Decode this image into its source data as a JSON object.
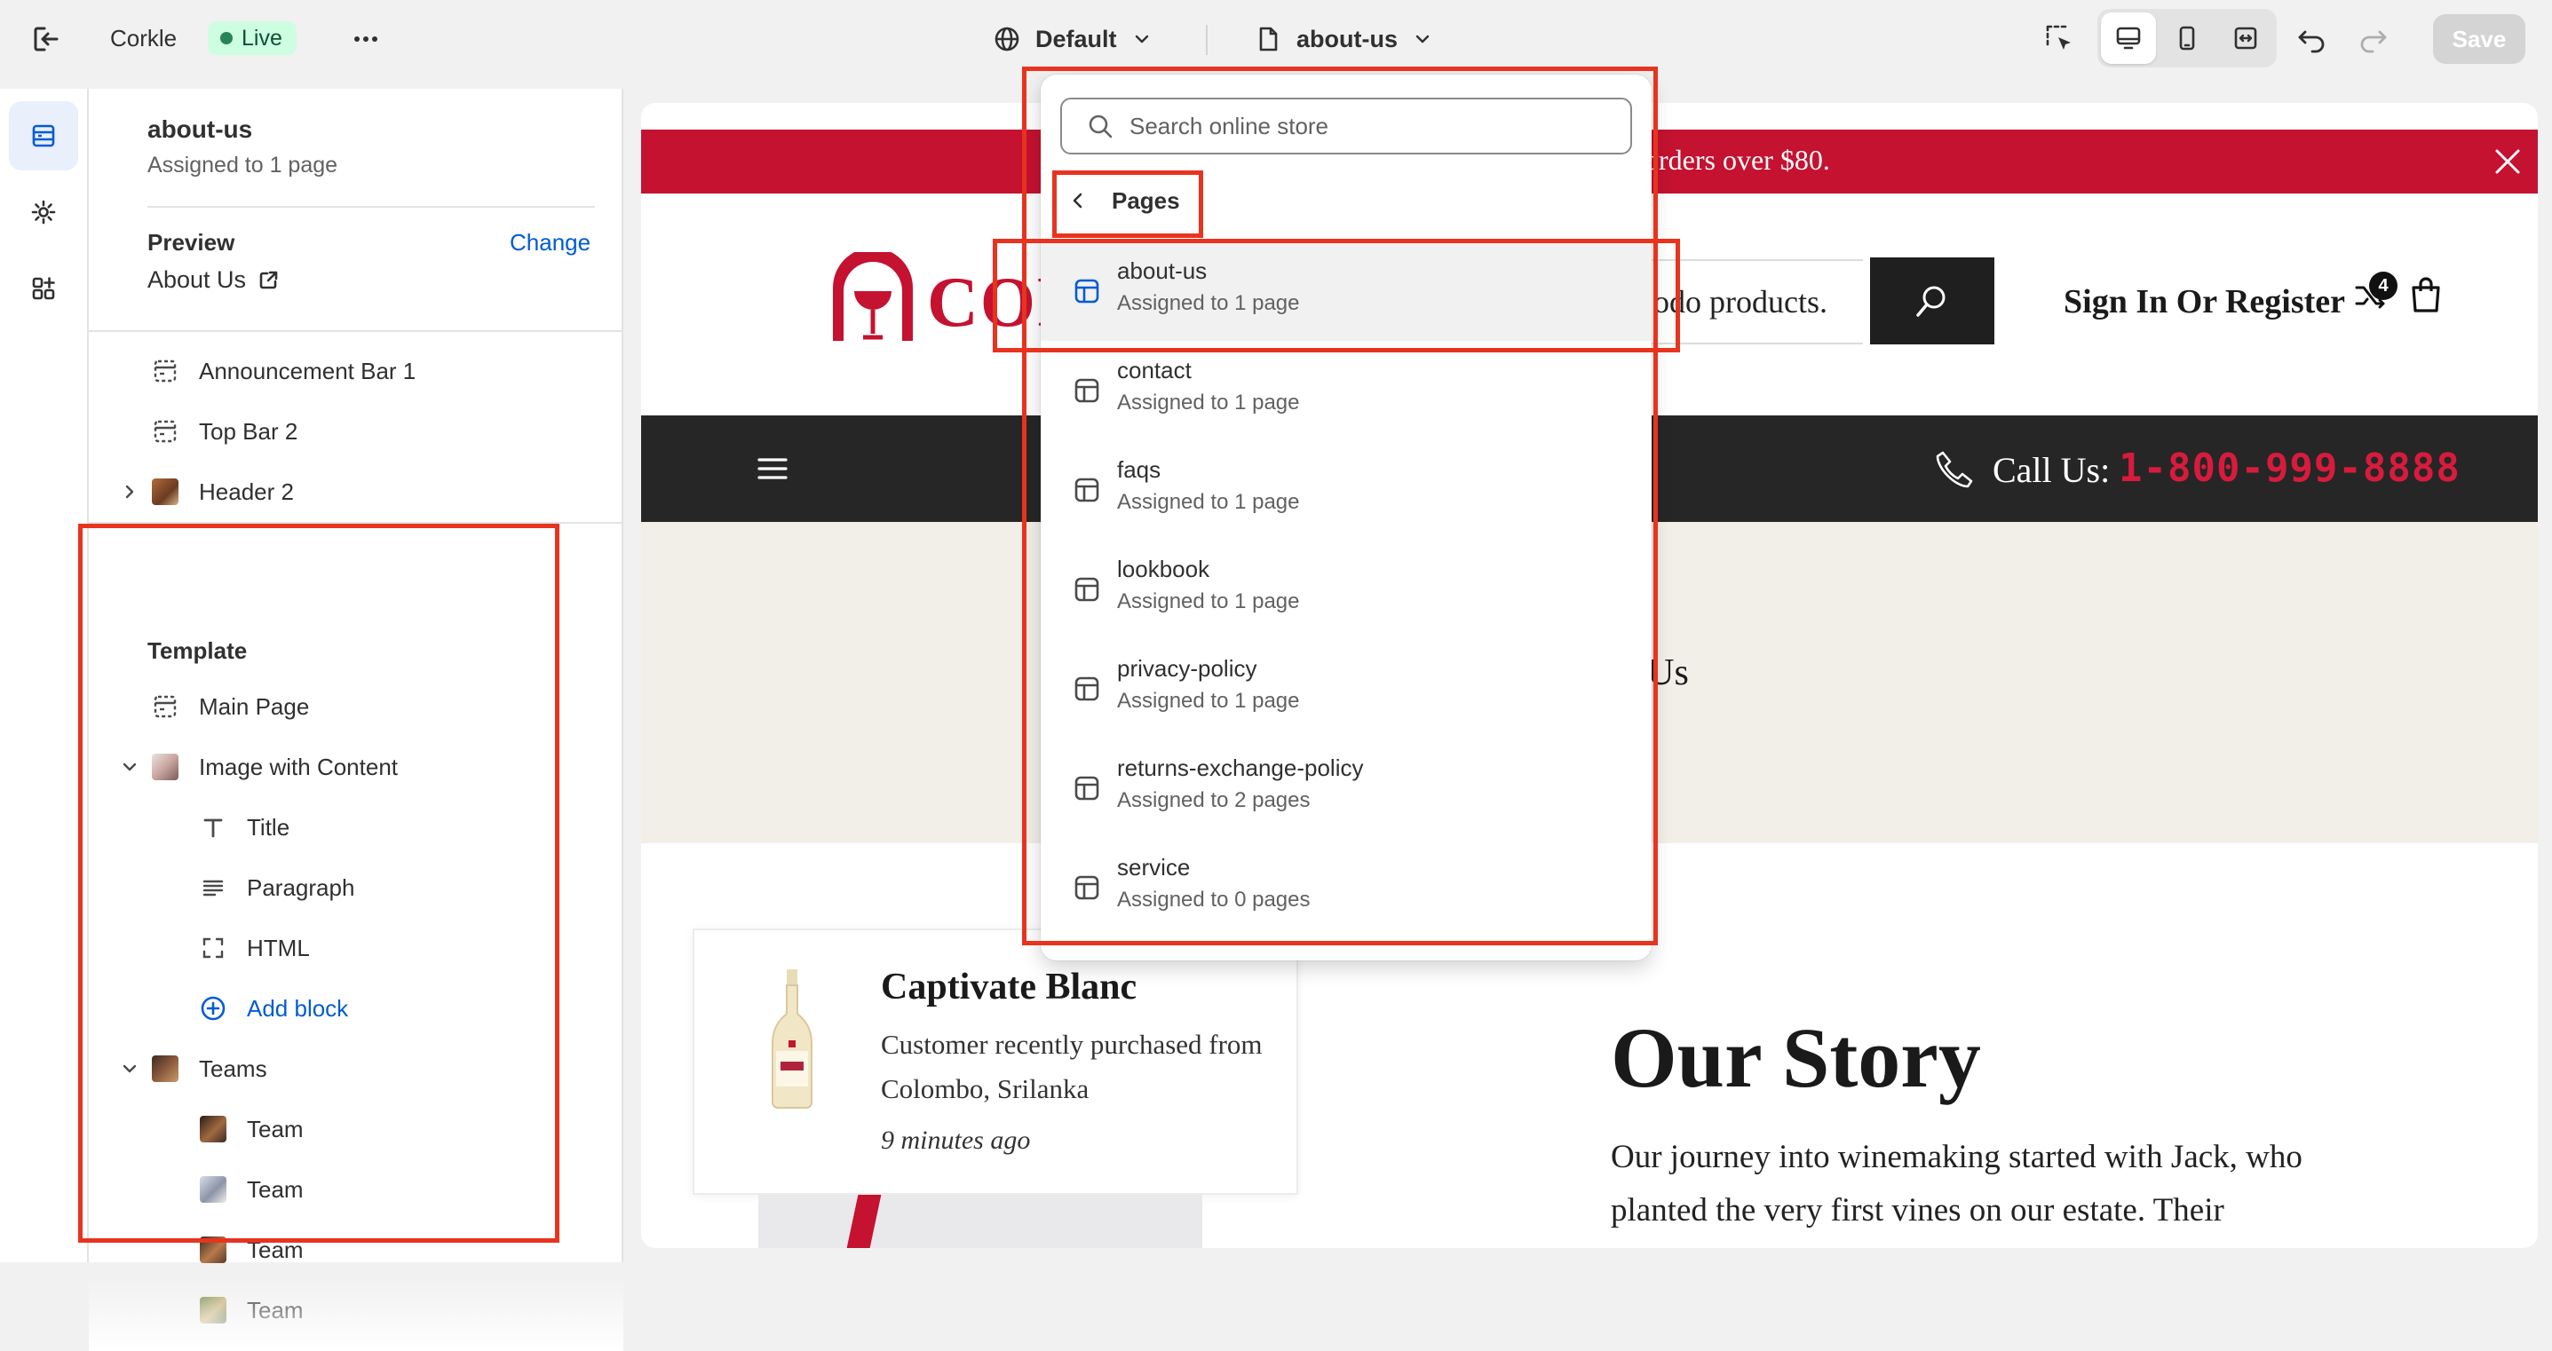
{
  "topbar": {
    "store_name": "Corkle",
    "status": "Live",
    "theme": "Default",
    "page": "about-us",
    "save_label": "Save"
  },
  "sidebar": {
    "title": "about-us",
    "subtitle": "Assigned to 1 page",
    "preview_label": "Preview",
    "change_label": "Change",
    "preview_page": "About Us",
    "header_sections": [
      "Announcement Bar 1",
      "Top Bar 2",
      "Header 2"
    ],
    "template_label": "Template",
    "template_items": {
      "main_page": "Main Page",
      "image_with_content": "Image with Content",
      "title": "Title",
      "paragraph": "Paragraph",
      "html": "HTML",
      "add_block": "Add block",
      "teams": "Teams",
      "team": "Team"
    }
  },
  "dropdown": {
    "search_placeholder": "Search online store",
    "back_label": "Pages",
    "items": [
      {
        "name": "about-us",
        "sub": "Assigned to 1 page"
      },
      {
        "name": "contact",
        "sub": "Assigned to 1 page"
      },
      {
        "name": "faqs",
        "sub": "Assigned to 1 page"
      },
      {
        "name": "lookbook",
        "sub": "Assigned to 1 page"
      },
      {
        "name": "privacy-policy",
        "sub": "Assigned to 1 page"
      },
      {
        "name": "returns-exchange-policy",
        "sub": "Assigned to 2 pages"
      },
      {
        "name": "service",
        "sub": "Assigned to 0 pages"
      }
    ]
  },
  "store": {
    "announcement": "orders over $80.",
    "logo_text": "COR",
    "search_tail": "odo products.",
    "sign_in": "Sign In Or Register",
    "compare_count": "4",
    "call_label": "Call Us:",
    "call_number": "1-800-999-8888",
    "hero_title": "ut Us",
    "card": {
      "title": "Captivate Blanc",
      "text": "Customer recently purchased from Colombo, Srilanka",
      "time": "9 minutes ago"
    },
    "story_title": "Our Story",
    "story_text": "Our journey into winemaking started with Jack, who planted the very first vines on our estate. Their"
  },
  "colors": {
    "accent_blue": "#005bd3",
    "live_green": "#cdfee1",
    "brand_red": "#c41230",
    "annotation_red": "#e8331f"
  }
}
